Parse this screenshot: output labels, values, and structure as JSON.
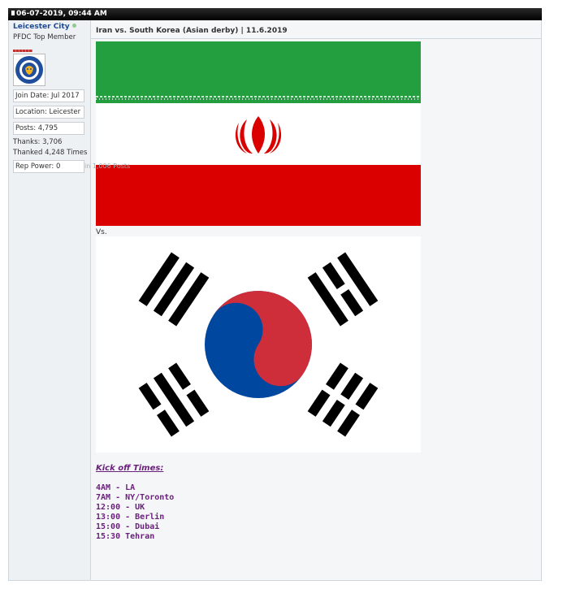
{
  "post": {
    "datetime": "06-07-2019, 09:44 AM",
    "title": "Iran vs. South Korea (Asian derby) | 11.6.2019",
    "vs_text": "Vs.",
    "kickoff_heading": "Kick off Times:",
    "kickoff_times": [
      "4AM - LA",
      "7AM - NY/Toronto",
      "12:00 - UK",
      "13:00 - Berlin",
      "15:00 - Dubai",
      "15:30 Tehran"
    ]
  },
  "user": {
    "name": "Leicester City",
    "title": "PFDC Top Member",
    "join_date": "Join Date:  Jul 2017",
    "location": "Location:  Leicester",
    "posts": "Posts:  4,795",
    "thanks": "Thanks:  3,706",
    "thanked": "Thanked 4,248 Times",
    "thanked_overlap": "in 1,006 Posts",
    "rep_power": "Rep Power:  0"
  },
  "colors": {
    "header_bg": "#000000",
    "username": "#1a4a9c",
    "kickoff_text": "#6b1f7d",
    "iran_green": "#239f40",
    "iran_red": "#da0000",
    "korea_red": "#cd2e3a",
    "korea_blue": "#0047a0"
  },
  "icons": {
    "online_status": "online-dot-icon",
    "avatar": "leicester-city-crest-icon"
  }
}
